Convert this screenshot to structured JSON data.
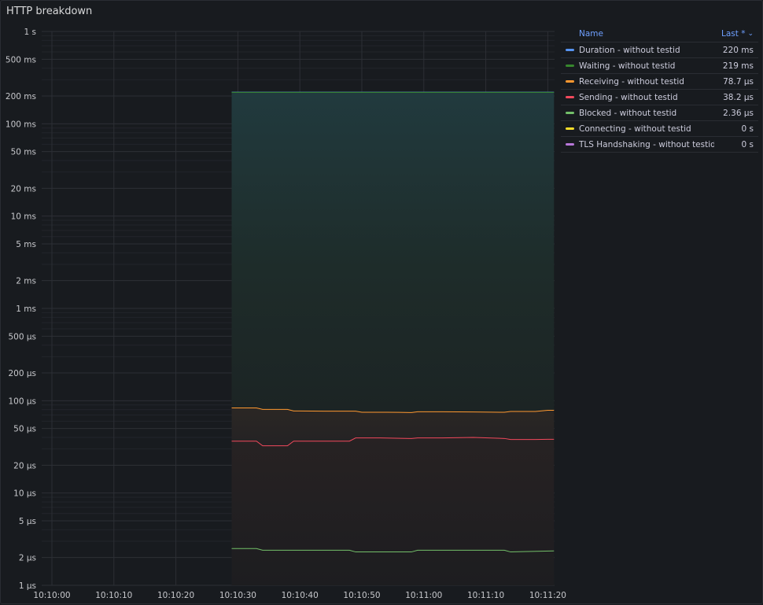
{
  "panel": {
    "title": "HTTP breakdown"
  },
  "legend": {
    "header_name": "Name",
    "header_last": "Last *",
    "sort_icon": "chevron-down-icon",
    "items": [
      {
        "name": "Duration - without testid",
        "value": "220 ms",
        "color": "#5794f2"
      },
      {
        "name": "Waiting - without testid",
        "value": "219 ms",
        "color": "#37872d"
      },
      {
        "name": "Receiving - without testid",
        "value": "78.7 µs",
        "color": "#ff9830"
      },
      {
        "name": "Sending - without testid",
        "value": "38.2 µs",
        "color": "#f2495c"
      },
      {
        "name": "Blocked - without testid",
        "value": "2.36 µs",
        "color": "#73bf69"
      },
      {
        "name": "Connecting - without testid",
        "value": "0 s",
        "color": "#fade2a"
      },
      {
        "name": "TLS Handshaking - without testid",
        "value": "0 s",
        "color": "#b877d9"
      }
    ]
  },
  "chart_data": {
    "type": "line",
    "yscale": "log",
    "ylim": [
      "1 µs",
      "1 s"
    ],
    "yticks": [
      "1 s",
      "500 ms",
      "200 ms",
      "100 ms",
      "50 ms",
      "20 ms",
      "10 ms",
      "5 ms",
      "2 ms",
      "1 ms",
      "500 µs",
      "200 µs",
      "100 µs",
      "50 µs",
      "20 µs",
      "10 µs",
      "5 µs",
      "2 µs",
      "1 µs"
    ],
    "ytick_values_seconds": [
      1,
      0.5,
      0.2,
      0.1,
      0.05,
      0.02,
      0.01,
      0.005,
      0.002,
      0.001,
      0.0005,
      0.0002,
      0.0001,
      5e-05,
      2e-05,
      1e-05,
      5e-06,
      2e-06,
      1e-06
    ],
    "xticks": [
      "10:10:00",
      "10:10:10",
      "10:10:20",
      "10:10:30",
      "10:10:40",
      "10:10:50",
      "10:11:00",
      "10:11:10",
      "10:11:20"
    ],
    "x_start_seconds": 0,
    "x_end_seconds": 81,
    "series": [
      {
        "name": "Duration - without testid",
        "color": "#5794f2",
        "x": [
          29,
          81
        ],
        "y": [
          0.22,
          0.22
        ]
      },
      {
        "name": "Waiting - without testid",
        "color": "#37872d",
        "x": [
          29,
          81
        ],
        "y": [
          0.219,
          0.219
        ]
      },
      {
        "name": "Receiving - without testid",
        "color": "#ff9830",
        "x": [
          29,
          33,
          34,
          38,
          39,
          44,
          49,
          50,
          54,
          58,
          59,
          63,
          68,
          73,
          74,
          78,
          80,
          81
        ],
        "y": [
          8.35e-05,
          8.35e-05,
          8.05e-05,
          8.05e-05,
          7.75e-05,
          7.7e-05,
          7.7e-05,
          7.5e-05,
          7.5e-05,
          7.45e-05,
          7.6e-05,
          7.6e-05,
          7.55e-05,
          7.5e-05,
          7.65e-05,
          7.65e-05,
          7.87e-05,
          7.87e-05
        ]
      },
      {
        "name": "Sending - without testid",
        "color": "#f2495c",
        "x": [
          29,
          33,
          34,
          38,
          39,
          44,
          48,
          49,
          53,
          58,
          59,
          63,
          68,
          73,
          74,
          78,
          80,
          81
        ],
        "y": [
          3.65e-05,
          3.65e-05,
          3.25e-05,
          3.25e-05,
          3.65e-05,
          3.65e-05,
          3.65e-05,
          3.95e-05,
          3.95e-05,
          3.9e-05,
          3.95e-05,
          3.95e-05,
          4e-05,
          3.9e-05,
          3.8e-05,
          3.8e-05,
          3.82e-05,
          3.82e-05
        ]
      },
      {
        "name": "Blocked - without testid",
        "color": "#73bf69",
        "x": [
          29,
          33,
          34,
          43,
          48,
          49,
          58,
          59,
          68,
          73,
          74,
          81
        ],
        "y": [
          2.5e-06,
          2.5e-06,
          2.4e-06,
          2.4e-06,
          2.4e-06,
          2.3e-06,
          2.3e-06,
          2.4e-06,
          2.4e-06,
          2.4e-06,
          2.3e-06,
          2.36e-06
        ]
      },
      {
        "name": "Connecting - without testid",
        "color": "#fade2a",
        "x": [],
        "y": []
      },
      {
        "name": "TLS Handshaking - without testid",
        "color": "#b877d9",
        "x": [],
        "y": []
      }
    ],
    "grid": true,
    "legend_position": "right"
  }
}
